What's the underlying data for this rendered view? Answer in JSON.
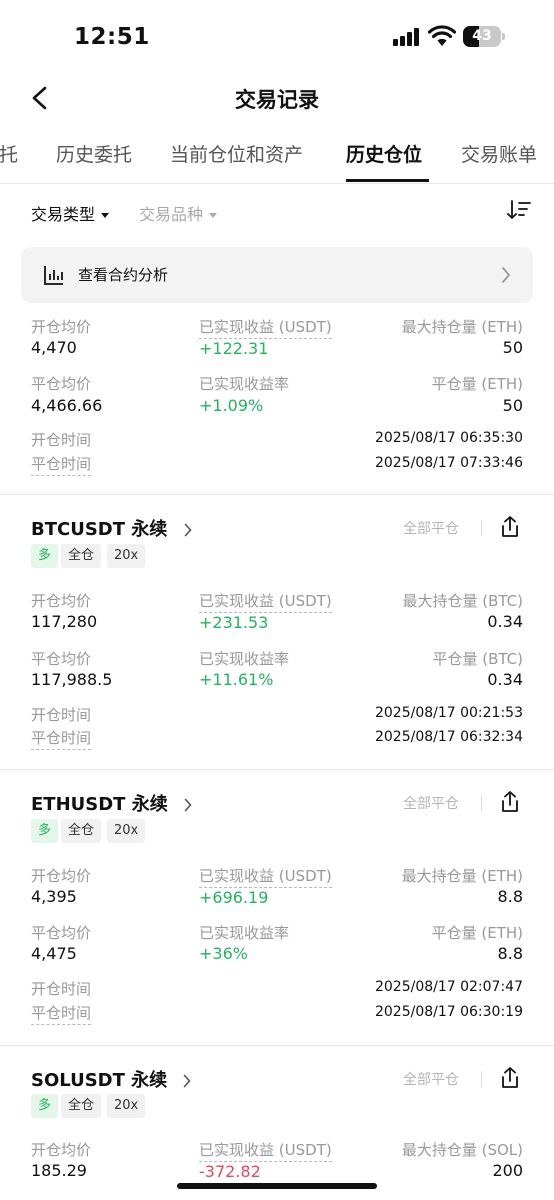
{
  "status_bar": {
    "time": "12:51",
    "battery": "43",
    "battery_level": 0.43
  },
  "header": {
    "title": "交易记录"
  },
  "tabs": [
    {
      "label": "托"
    },
    {
      "label": "历史委托"
    },
    {
      "label": "当前仓位和资产"
    },
    {
      "label": "历史仓位",
      "active": true
    },
    {
      "label": "交易账单"
    }
  ],
  "filters": {
    "trade_type": "交易类型",
    "instrument": "交易品种"
  },
  "analysis": {
    "label": "查看合约分析"
  },
  "labels": {
    "open_avg": "开仓均价",
    "close_avg": "平仓均价",
    "realized_pnl": "已实现收益 (USDT)",
    "realized_pnl_rate": "已实现收益率",
    "open_time": "开仓时间",
    "close_time": "平仓时间",
    "close_all": "全部平仓"
  },
  "partial_card": {
    "open_avg": "4,470",
    "close_avg": "4,466.66",
    "pnl": "+122.31",
    "pnl_rate": "+1.09%",
    "max_pos_label": "最大持仓量 (ETH)",
    "max_pos": "50",
    "close_qty_label": "平仓量 (ETH)",
    "close_qty": "50",
    "open_time": "2025/08/17 06:35:30",
    "close_time": "2025/08/17 07:33:46"
  },
  "cards": [
    {
      "symbol": "BTCUSDT 永续",
      "tags": [
        "多",
        "全仓",
        "20x"
      ],
      "open_avg": "117,280",
      "close_avg": "117,988.5",
      "pnl": "+231.53",
      "pnl_rate": "+11.61%",
      "max_pos_label": "最大持仓量 (BTC)",
      "max_pos": "0.34",
      "close_qty_label": "平仓量 (BTC)",
      "close_qty": "0.34",
      "open_time": "2025/08/17 00:21:53",
      "close_time": "2025/08/17 06:32:34"
    },
    {
      "symbol": "ETHUSDT 永续",
      "tags": [
        "多",
        "全仓",
        "20x"
      ],
      "open_avg": "4,395",
      "close_avg": "4,475",
      "pnl": "+696.19",
      "pnl_rate": "+36%",
      "max_pos_label": "最大持仓量 (ETH)",
      "max_pos": "8.8",
      "close_qty_label": "平仓量 (ETH)",
      "close_qty": "8.8",
      "open_time": "2025/08/17 02:07:47",
      "close_time": "2025/08/17 06:30:19"
    },
    {
      "symbol": "SOLUSDT 永续",
      "tags": [
        "多",
        "全仓",
        "20x"
      ],
      "open_avg": "185.29",
      "pnl": "-372.82",
      "max_pos_label": "最大持仓量 (SOL)",
      "max_pos": "200"
    }
  ],
  "colors": {
    "positive": "#22b45e",
    "negative": "#e8485d",
    "long_tag_bg": "#e3f6e9"
  }
}
